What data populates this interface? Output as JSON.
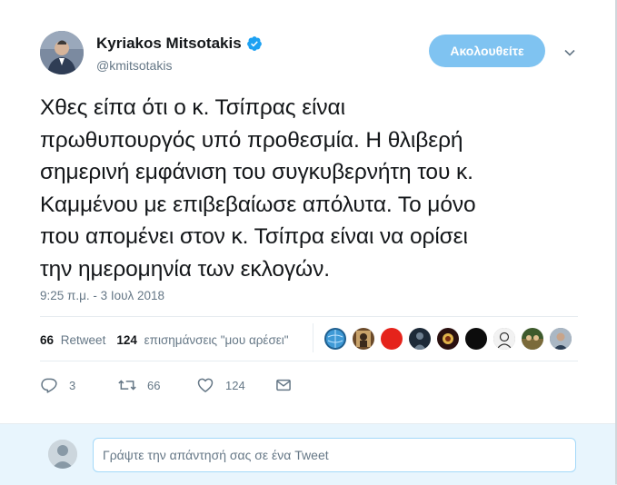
{
  "user": {
    "name": "Kyriakos Mitsotakis",
    "handle": "@kmitsotakis",
    "avatar_icon": "profile-photo"
  },
  "follow_button": {
    "label": "Ακολουθείτε"
  },
  "tweet": {
    "text": "Χθες είπα ότι ο κ. Τσίπρας είναι\nπρωθυπουργός υπό προθεσμία.  Η θλιβερή\nσημερινή εμφάνιση του συγκυβερνήτη του κ.\nΚαμμένου με επιβεβαίωσε απόλυτα.  Το μόνο\nπου απομένει στον κ. Τσίπρα είναι να ορίσει\nτην ημερομηνία των εκλογών.",
    "timestamp": "9:25 π.μ. - 3 Ιουλ 2018"
  },
  "stats": {
    "retweets_count": "66",
    "retweets_label": "Retweet",
    "likes_count": "124",
    "likes_label": "επισημάνσεις \"μου αρέσει\""
  },
  "likers": [
    {
      "icon": "globe-avatar",
      "color": "#1f5f8f"
    },
    {
      "icon": "portrait-avatar",
      "color": "#6b4a2a"
    },
    {
      "icon": "red-avatar",
      "color": "#e5231b"
    },
    {
      "icon": "night-avatar",
      "color": "#1d2a38"
    },
    {
      "icon": "badge-avatar",
      "color": "#2a0f0f"
    },
    {
      "icon": "dark-avatar",
      "color": "#0c0c0c"
    },
    {
      "icon": "sketch-avatar",
      "color": "#8e8e8e"
    },
    {
      "icon": "group-avatar",
      "color": "#3d5a2c"
    },
    {
      "icon": "man-avatar",
      "color": "#5d6f80"
    }
  ],
  "actions": {
    "replies": "3",
    "retweets": "66",
    "likes": "124"
  },
  "reply": {
    "placeholder": "Γράψτε την απάντησή σας σε ένα Tweet"
  },
  "colors": {
    "accent": "#1da1f2",
    "follow_bg": "#7fc3f1",
    "muted": "#657786"
  }
}
